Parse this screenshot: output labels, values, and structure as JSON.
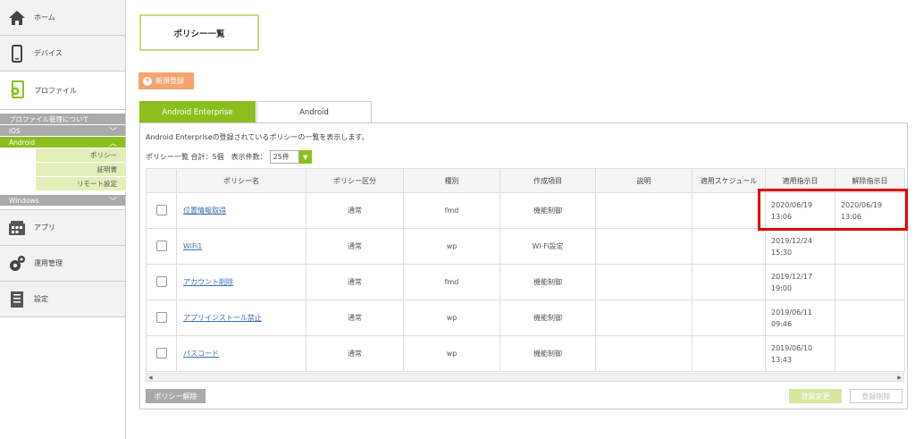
{
  "sidebar": {
    "home": "ホーム",
    "devices": "デバイス",
    "profile": "プロファイル",
    "profile_about": "プロファイル管理について",
    "ios": "iOS",
    "android": "Android",
    "android_items": [
      "ポリシー",
      "証明書",
      "リモート設定"
    ],
    "windows": "Windows",
    "apps": "アプリ",
    "operations": "運用管理",
    "settings": "設定"
  },
  "page": {
    "title": "ポリシー一覧",
    "new_button": "新規登録",
    "tabs": [
      "Android Enterprise",
      "Android"
    ],
    "description": "Android Enterpriseの登録されているポリシーの一覧を表示します。",
    "summary": "ポリシー一覧 合計：5個　表示件数：",
    "per_page": "25件"
  },
  "table": {
    "headers": [
      "ポリシー名",
      "ポリシー区分",
      "種別",
      "作成項目",
      "説明",
      "適用スケジュール",
      "適用指示日",
      "解除指示日"
    ],
    "rows": [
      {
        "name": "位置情報取得",
        "category": "通常",
        "type": "fmd",
        "item": "機能制御",
        "desc": "",
        "schedule": "",
        "apply": "2020/06/19\n13:06",
        "release": "2020/06/19\n13:06"
      },
      {
        "name": "WiFi1",
        "category": "通常",
        "type": "wp",
        "item": "Wi-Fi設定",
        "desc": "",
        "schedule": "",
        "apply": "2019/12/24\n15:30",
        "release": ""
      },
      {
        "name": "アカウント削除",
        "category": "通常",
        "type": "fmd",
        "item": "機能制御",
        "desc": "",
        "schedule": "",
        "apply": "2019/12/17\n19:00",
        "release": ""
      },
      {
        "name": "アプリインストール禁止",
        "category": "通常",
        "type": "wp",
        "item": "機能制御",
        "desc": "",
        "schedule": "",
        "apply": "2019/06/11\n09:46",
        "release": ""
      },
      {
        "name": "パスコード",
        "category": "通常",
        "type": "wp",
        "item": "機能制御",
        "desc": "",
        "schedule": "",
        "apply": "2019/06/10\n13:43",
        "release": ""
      }
    ]
  },
  "footer": {
    "unset_button": "ポリシー解除",
    "change_button": "登録変更",
    "delete_button": "登録削除"
  },
  "colors": {
    "accent": "#8cbf1e",
    "new_button": "#f3a46f",
    "highlight": "#e00000"
  }
}
